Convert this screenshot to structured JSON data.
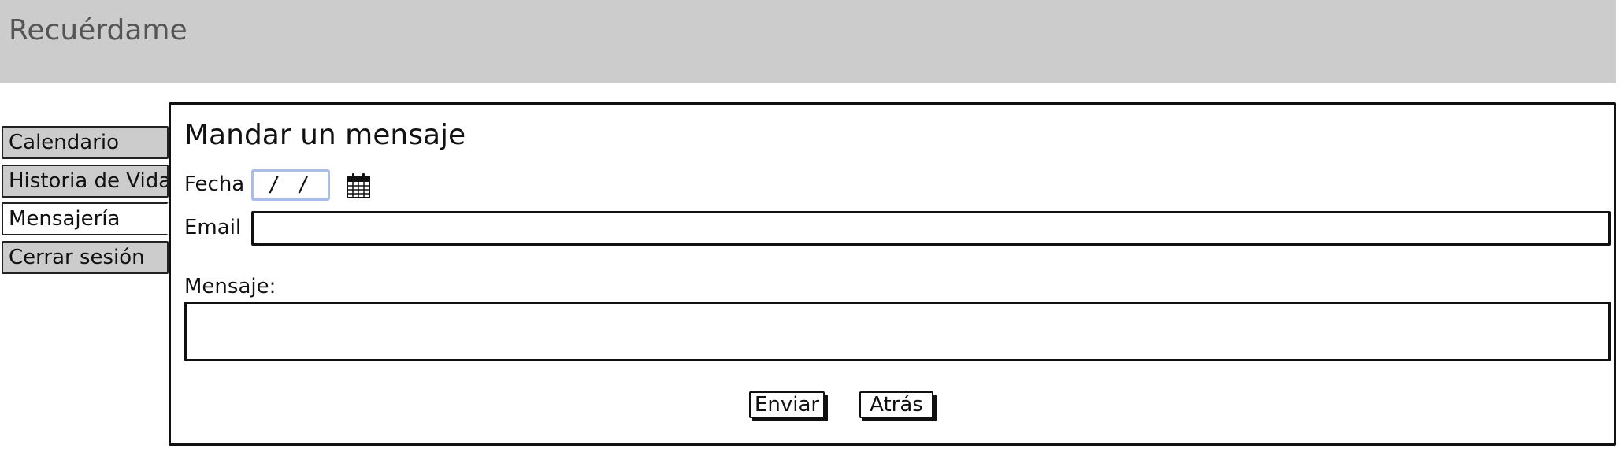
{
  "header": {
    "title": "Recuérdame",
    "background": "#cccccc"
  },
  "sidebar": {
    "items": [
      {
        "label": "Calendario",
        "active": false
      },
      {
        "label": "Historia de Vida",
        "active": false
      },
      {
        "label": "Mensajería",
        "active": true
      },
      {
        "label": "Cerrar sesión",
        "active": false
      }
    ]
  },
  "form": {
    "title": "Mandar un mensaje",
    "date_label": "Fecha",
    "date_value": "/ /",
    "calendar_icon": "calendar-icon",
    "email_label": "Email",
    "email_value": "",
    "message_label": "Mensaje:",
    "message_value": "",
    "send_label": "Enviar",
    "back_label": "Atrás"
  },
  "colors": {
    "tab_inactive": "#cccccc",
    "date_focus_border": "#a9bde8",
    "title_text": "#555555"
  }
}
